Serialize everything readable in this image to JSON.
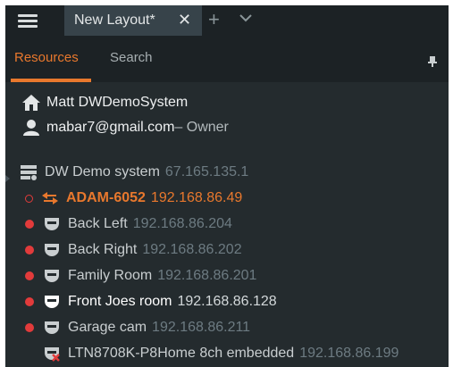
{
  "tabbar": {
    "active_tab_title": "New Layout*",
    "close_glyph": "✕",
    "add_tab_glyph": "+"
  },
  "panel": {
    "tabs": [
      {
        "label": "Resources",
        "active": true
      },
      {
        "label": "Search",
        "active": false
      }
    ]
  },
  "user": {
    "system_name": "Matt DWDemoSystem",
    "email": "mabar7@gmail.com",
    "role": " – Owner"
  },
  "tree": {
    "server": {
      "name": "DW Demo system",
      "ip": "67.165.135.1"
    },
    "devices": [
      {
        "name": "ADAM-6052",
        "ip": "192.168.86.49",
        "status": "offline-io",
        "icon": "io-module-icon"
      },
      {
        "name": "Back Left",
        "ip": "192.168.86.204",
        "status": "recording",
        "icon": "camera-icon"
      },
      {
        "name": "Back Right",
        "ip": "192.168.86.202",
        "status": "recording",
        "icon": "camera-icon"
      },
      {
        "name": "Family Room",
        "ip": "192.168.86.201",
        "status": "recording",
        "icon": "camera-icon"
      },
      {
        "name": "Front Joes room",
        "ip": "192.168.86.128",
        "status": "recording-selected",
        "icon": "camera-icon"
      },
      {
        "name": "Garage cam",
        "ip": "192.168.86.211",
        "status": "recording",
        "icon": "camera-icon"
      },
      {
        "name": "LTN8708K-P8Home 8ch embedded",
        "ip": "192.168.86.199",
        "status": "error",
        "icon": "camera-error-icon"
      }
    ]
  },
  "colors": {
    "accent": "#e8782d",
    "recording_dot": "#e23b3b",
    "background": "#242b2e",
    "header": "#1c2225"
  }
}
